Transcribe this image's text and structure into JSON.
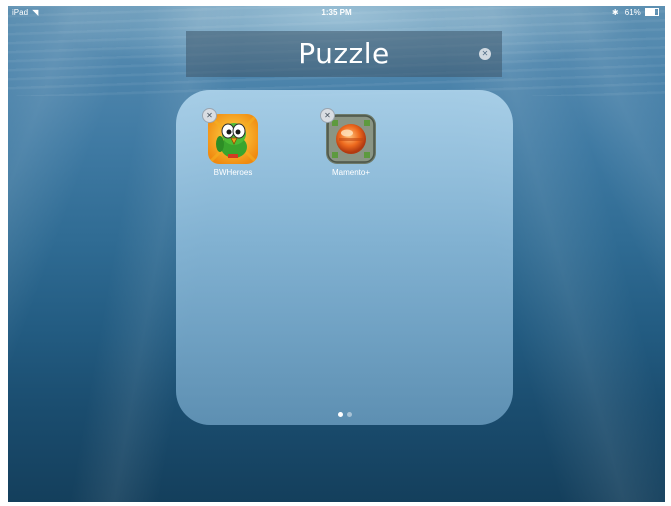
{
  "status_bar": {
    "device": "iPad",
    "time": "1:35 PM",
    "battery": "61%",
    "wifi_icon": "wifi-icon",
    "bluetooth_icon": "bluetooth-icon",
    "battery_icon": "battery-icon"
  },
  "folder": {
    "name": "Puzzle",
    "clear_icon": "clear-text-icon",
    "apps": [
      {
        "label": "BWHeroes",
        "icon": "bwheroes-app-icon",
        "accent": "#f2a81c"
      },
      {
        "label": "Mamento+",
        "icon": "mamento-app-icon",
        "accent": "#e8752a"
      }
    ],
    "page_count": 2,
    "current_page": 1
  },
  "colors": {
    "wallpaper_top": "#5d90b2",
    "wallpaper_bottom": "#143f5c",
    "folder_panel": "#a9d0ea"
  }
}
